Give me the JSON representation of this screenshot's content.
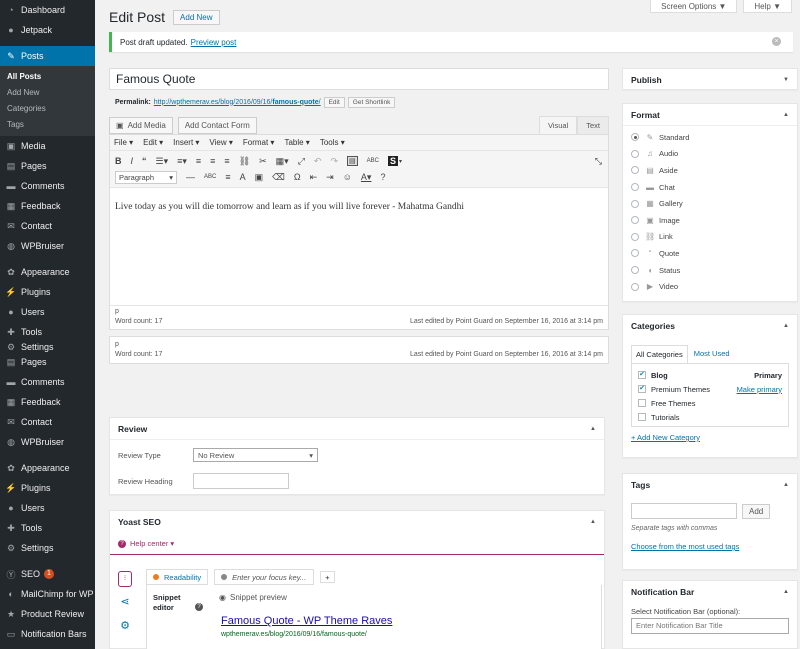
{
  "sidebar": {
    "items_top": [
      {
        "label": "Dashboard",
        "icon": "dashboard-icon"
      },
      {
        "label": "Jetpack",
        "icon": "jetpack-icon"
      },
      {
        "label": "Posts",
        "icon": "pin-icon"
      }
    ],
    "posts_sub": [
      "All Posts",
      "Add New",
      "Categories",
      "Tags"
    ],
    "items_mid": [
      "Media",
      "Pages",
      "Comments",
      "Feedback",
      "Contact",
      "WPBruiser"
    ],
    "items_mid2": [
      "Appearance",
      "Plugins",
      "Users",
      "Tools",
      "Settings"
    ],
    "items_dup": [
      "Pages",
      "Comments",
      "Feedback",
      "Contact",
      "WPBruiser"
    ],
    "items_dup2": [
      "Appearance",
      "Plugins",
      "Users",
      "Tools",
      "Settings"
    ],
    "items_bottom": [
      {
        "label": "SEO",
        "badge": "1"
      },
      {
        "label": "MailChimp for WP"
      },
      {
        "label": "Product Review"
      },
      {
        "label": "Notification Bars"
      }
    ]
  },
  "top_buttons": {
    "screen_options": "Screen Options ▼",
    "help": "Help ▼"
  },
  "header": {
    "title": "Edit Post",
    "add_new": "Add New"
  },
  "notice": {
    "text": "Post draft updated.",
    "link": "Preview post"
  },
  "post": {
    "title": "Famous Quote",
    "permalink_label": "Permalink:",
    "permalink_base": "http://wpthemerav.es/blog/2016/09/16/",
    "permalink_slug": "famous-quote",
    "permalink_end": "/",
    "edit_btn": "Edit",
    "shortlink_btn": "Get Shortlink"
  },
  "editor": {
    "add_media": "Add Media",
    "add_contact_form": "Add Contact Form",
    "tab_visual": "Visual",
    "tab_text": "Text",
    "menus": [
      "File ▾",
      "Edit ▾",
      "Insert ▾",
      "View ▾",
      "Format ▾",
      "Table ▾",
      "Tools ▾"
    ],
    "paragraph_select": "Paragraph",
    "content": "Live today as you will die tomorrow and learn as if you will live forever - Mahatma Gandhi",
    "path": "p",
    "word_count": "Word count: 17",
    "last_edited": "Last edited by Point Guard on September 16, 2016 at 3:14 pm"
  },
  "review": {
    "title": "Review",
    "type_label": "Review Type",
    "type_value": "No Review",
    "heading_label": "Review Heading"
  },
  "yoast": {
    "title": "Yoast SEO",
    "help_center": "Help center ▾",
    "readability_tab": "Readability",
    "focus_placeholder": "Enter your focus key...",
    "add_tab": "+",
    "snippet_editor": "Snippet editor",
    "snippet_preview": "Snippet preview",
    "snippet_title": "Famous Quote - WP Theme Raves",
    "snippet_url": "wpthemerav.es/blog/2016/09/16/famous-quote/",
    "colors": {
      "readability_dot": "#ee7c1b",
      "focus_dot": "#888888"
    }
  },
  "publish": {
    "title": "Publish"
  },
  "format": {
    "title": "Format",
    "options": [
      {
        "label": "Standard",
        "icon": "pin-icon",
        "selected": true
      },
      {
        "label": "Audio",
        "icon": "audio-icon",
        "selected": false
      },
      {
        "label": "Aside",
        "icon": "aside-icon",
        "selected": false
      },
      {
        "label": "Chat",
        "icon": "chat-icon",
        "selected": false
      },
      {
        "label": "Gallery",
        "icon": "gallery-icon",
        "selected": false
      },
      {
        "label": "Image",
        "icon": "image-icon",
        "selected": false
      },
      {
        "label": "Link",
        "icon": "link-icon",
        "selected": false
      },
      {
        "label": "Quote",
        "icon": "quote-icon",
        "selected": false
      },
      {
        "label": "Status",
        "icon": "status-icon",
        "selected": false
      },
      {
        "label": "Video",
        "icon": "video-icon",
        "selected": false
      }
    ]
  },
  "categories": {
    "title": "Categories",
    "tab_all": "All Categories",
    "tab_used": "Most Used",
    "items": [
      {
        "label": "Blog",
        "checked": true,
        "right": "Primary",
        "bold": true
      },
      {
        "label": "Premium Themes",
        "checked": true,
        "right": "Make primary",
        "bold": false
      },
      {
        "label": "Free Themes",
        "checked": false,
        "right": "",
        "bold": false
      },
      {
        "label": "Tutorials",
        "checked": false,
        "right": "",
        "bold": false
      }
    ],
    "add_new": "+ Add New Category"
  },
  "tags": {
    "title": "Tags",
    "add_btn": "Add",
    "hint": "Separate tags with commas",
    "choose": "Choose from the most used tags"
  },
  "notification_bar": {
    "title": "Notification Bar",
    "select_label": "Select Notification Bar (optional):",
    "placeholder": "Enter Notification Bar Title"
  },
  "colors": {
    "accent": "#0073aa",
    "sidebar": "#23282d",
    "yoast": "#a4286a",
    "notice_border": "#46b450"
  }
}
